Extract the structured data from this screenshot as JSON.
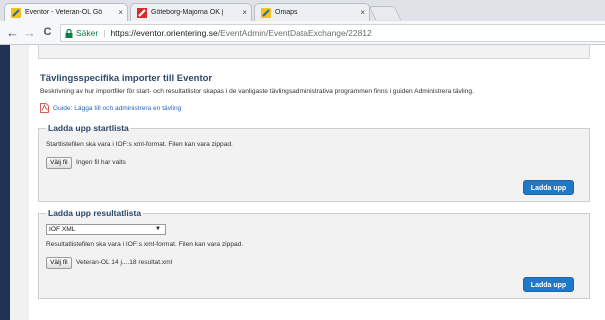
{
  "browser": {
    "tabs": [
      {
        "title": "Eventor - Veteran-OL Gö",
        "close": "×",
        "favicon_color": "#f0c419"
      },
      {
        "title": "Göteborg-Majorna OK |",
        "close": "×",
        "favicon_color": "#d0312d"
      },
      {
        "title": "Omaps",
        "close": "×",
        "favicon_color": "#f0c419"
      }
    ],
    "nav": {
      "back": "←",
      "forward": "→",
      "reload": "C"
    },
    "address": {
      "secure_label": "Säker",
      "separator": "|",
      "url_host": "https://eventor.orientering.se",
      "url_path": "/EventAdmin/EventDataExchange/22812"
    }
  },
  "page": {
    "heading": "Tävlingsspecifika importer till Eventor",
    "description": "Beskrivning av hur importfiler för start- och resultatlistor skapas i de vanligaste tävlingsadministrativa programmen finns i guiden Administrera tävling.",
    "guide_link": "Guide: Lägga till och administrera en tävling",
    "startlist": {
      "legend": "Ladda upp startlista",
      "info": "Startlistefilen ska vara i IOF:s xml-format. Filen kan vara zippad.",
      "file_button": "Välj fil",
      "file_name": "Ingen fil har valts",
      "upload_button": "Ladda upp"
    },
    "resultlist": {
      "legend": "Ladda upp resultatlista",
      "format_selected": "IOF XML",
      "format_caret": "▼",
      "info": "Resultatlistefilen ska vara i IOF:s xml-format. Filen kan vara zippad.",
      "file_button": "Välj fil",
      "file_name": "Veteran-OL 14 j....18 resultat.xml",
      "upload_button": "Ladda upp"
    }
  },
  "colors": {
    "heading": "#2a4a6b",
    "link": "#2a66b3",
    "button": "#2079c7",
    "sidebar": "#1f3254",
    "secure": "#0b8043"
  },
  "icons": {
    "lock": "lock-icon",
    "pdf": "pdf-icon",
    "favicon": "eventor-favicon-icon"
  }
}
